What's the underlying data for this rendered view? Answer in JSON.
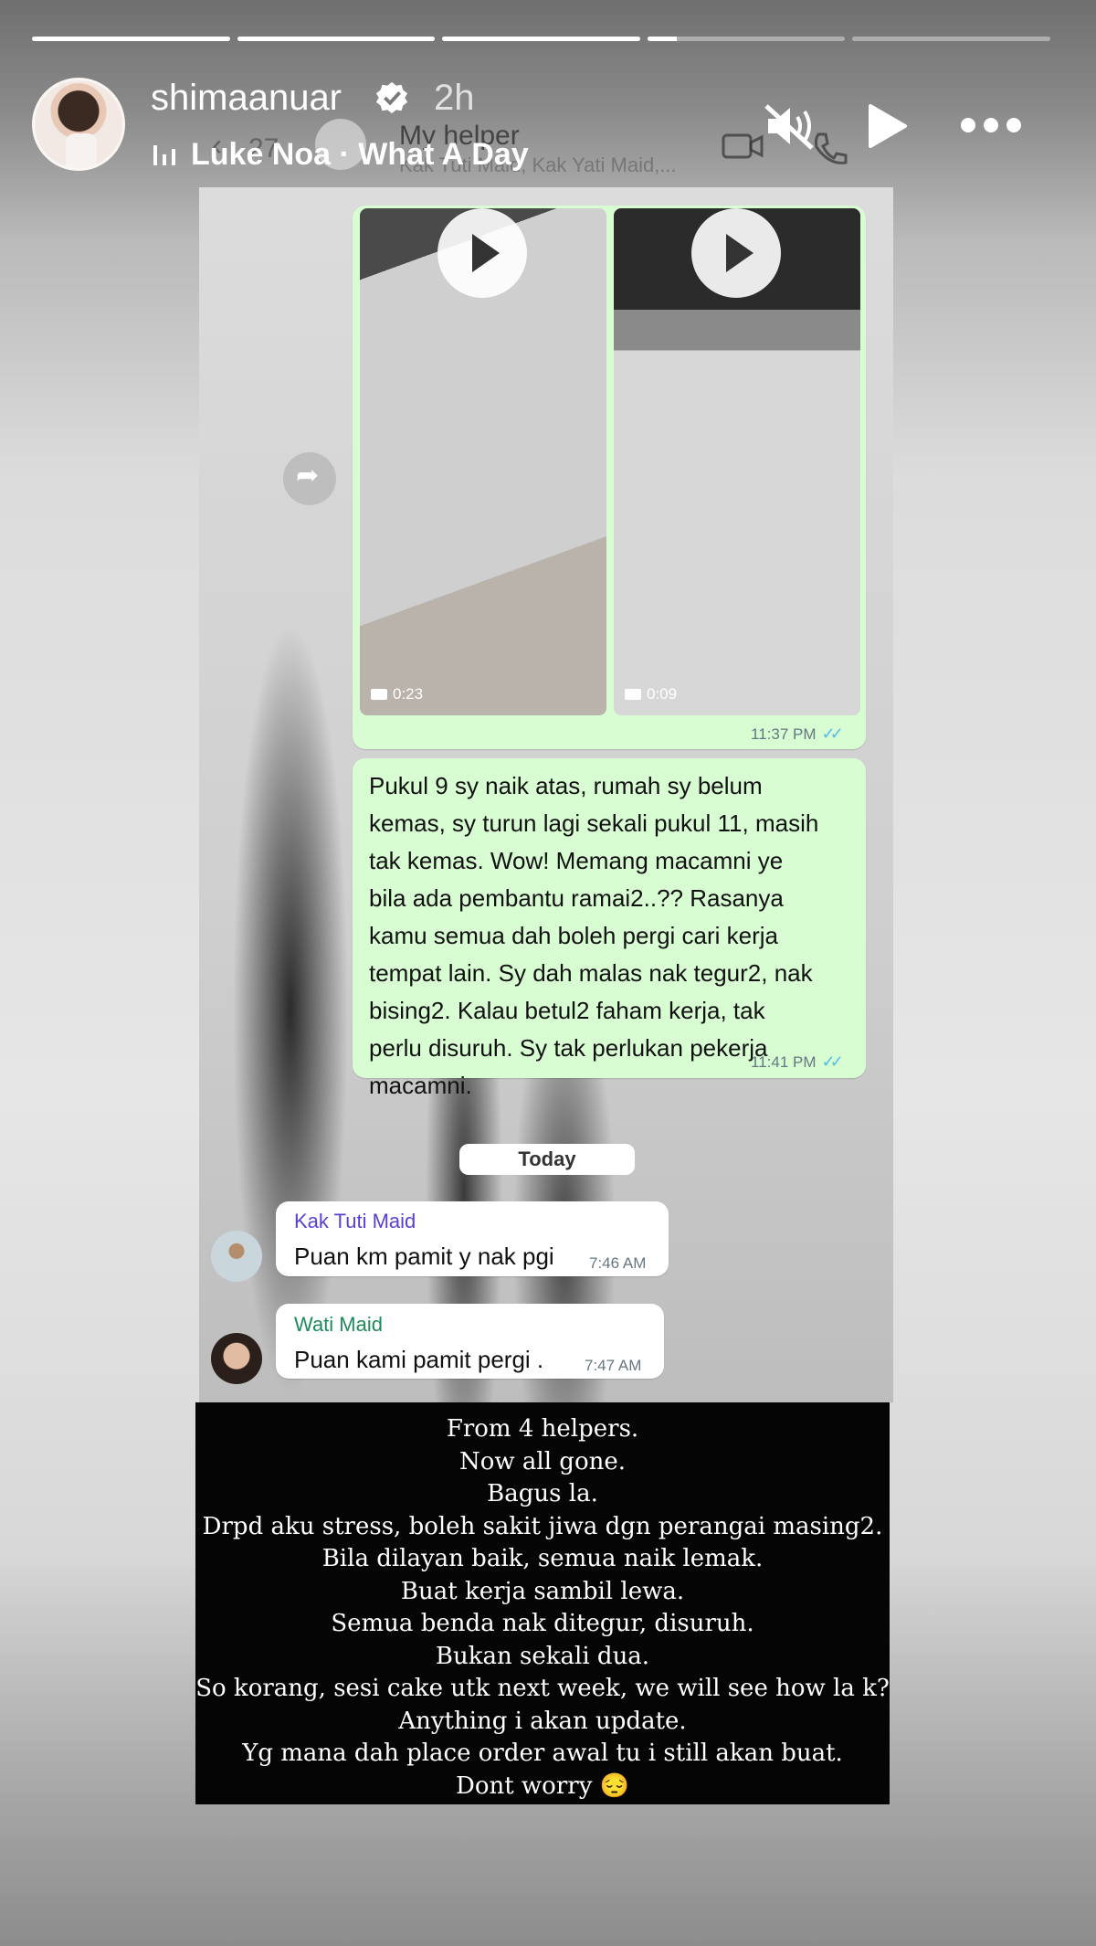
{
  "story": {
    "progress": [
      1,
      1,
      1,
      0.15,
      0
    ],
    "username": "shimaanuar",
    "time": "2h",
    "music": "Luke Noa · What A Day"
  },
  "whatsapp": {
    "back_count": "27",
    "group_title": "My helper",
    "group_subtitle": "Kak Tuti Maid, Kak Yati Maid,...",
    "video1_duration": "0:23",
    "video2_duration": "0:09",
    "media_time": "11:37 PM",
    "message_lines": [
      "Pukul 9 sy naik atas, rumah sy belum",
      "kemas, sy turun lagi sekali pukul 11, masih",
      "tak kemas. Wow! Memang macamni ye",
      "bila ada pembantu ramai2..?? Rasanya",
      "kamu semua dah boleh pergi cari kerja",
      "tempat lain. Sy dah malas nak tegur2, nak",
      "bising2. Kalau betul2 faham kerja, tak",
      "perlu disuruh. Sy tak perlukan pekerja",
      "macamni."
    ],
    "message_time": "11:41 PM",
    "day_separator": "Today",
    "incoming": [
      {
        "sender": "Kak Tuti Maid",
        "text": "Puan km pamit y nak pgi",
        "time": "7:46 AM",
        "color": "#5b3fd1"
      },
      {
        "sender": "Wati Maid",
        "text": "Puan kami  pamit pergi .",
        "time": "7:47 AM",
        "color": "#1f8a5b"
      }
    ]
  },
  "caption": {
    "lines": [
      "From 4 helpers.",
      "Now all gone.",
      "Bagus la.",
      "Drpd aku stress, boleh sakit jiwa dgn perangai masing2.",
      "Bila dilayan baik, semua naik lemak.",
      "Buat kerja sambil lewa.",
      "Semua benda nak ditegur, disuruh.",
      "Bukan sekali dua.",
      "So korang, sesi cake utk next week, we will see how la k?",
      "Anything i akan update.",
      "Yg mana dah place order awal tu i still akan buat.",
      "Dont worry 😔"
    ]
  }
}
